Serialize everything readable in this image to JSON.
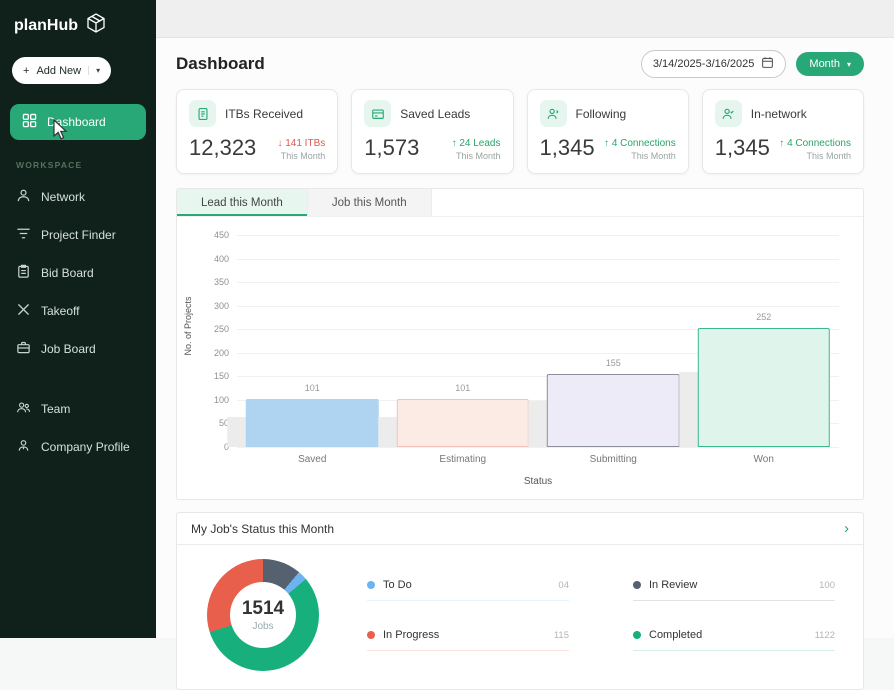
{
  "accent": "#28a877",
  "sidebar": {
    "logo": "planHub",
    "add_new": {
      "plus": "+",
      "label": "Add New",
      "caret": "▾"
    },
    "section_label": "WORKSPACE",
    "items": [
      {
        "label": "Dashboard",
        "icon": "dashboard-icon",
        "active": true
      },
      {
        "label": "Network",
        "icon": "person-icon"
      },
      {
        "label": "Project Finder",
        "icon": "filter-icon"
      },
      {
        "label": "Bid Board",
        "icon": "clipboard-icon"
      },
      {
        "label": "Takeoff",
        "icon": "takeoff-cross-icon"
      },
      {
        "label": "Job Board",
        "icon": "briefcase-icon"
      },
      {
        "label": "Team",
        "icon": "team-icon"
      },
      {
        "label": "Company Profile",
        "icon": "company-profile-icon"
      }
    ]
  },
  "header": {
    "title": "Dashboard",
    "date_range": "3/14/2025-3/16/2025",
    "period_button": {
      "label": "Month",
      "caret": "▾"
    }
  },
  "stats": [
    {
      "label": "ITBs Received",
      "value": "12,323",
      "arrow": "↓",
      "delta": "141 ITBs",
      "delta_color": "#e2574c",
      "sub": "This Month",
      "icon": "itb-document-icon"
    },
    {
      "label": "Saved Leads",
      "value": "1,573",
      "arrow": "↑",
      "delta": "24 Leads",
      "delta_color": "#27a567",
      "sub": "This Month",
      "icon": "saved-leads-card-icon"
    },
    {
      "label": "Following",
      "value": "1,345",
      "arrow": "↑",
      "delta": "4 Connections",
      "delta_color": "#27a567",
      "sub": "This Month",
      "icon": "following-person-icon"
    },
    {
      "label": "In-network",
      "value": "1,345",
      "arrow": "↑",
      "delta": "4 Connections",
      "delta_color": "#27a567",
      "sub": "This Month",
      "icon": "in-network-person-icon"
    }
  ],
  "tabs": [
    {
      "label": "Lead this Month",
      "active": true
    },
    {
      "label": "Job this Month",
      "active": false
    }
  ],
  "chart_data": [
    {
      "type": "bar",
      "categories": [
        "Saved",
        "Estimating",
        "Submitting",
        "Won"
      ],
      "values": [
        101,
        101,
        155,
        252
      ],
      "xlabel": "Status",
      "ylabel": "No. of Projects",
      "ylim": [
        0,
        450
      ],
      "yticks": [
        0,
        50,
        100,
        150,
        200,
        250,
        300,
        350,
        400,
        450
      ],
      "grid": true,
      "legend_position": "none",
      "bar_colors": [
        "#aed4f2",
        "#fcebe4",
        "#edebf7",
        "#dff4eb"
      ],
      "bar_borders": [
        "#aed4f2",
        "#f2c4b8",
        "#8a8f9b",
        "#3bb98e"
      ]
    },
    {
      "type": "pie",
      "title": "My Job's Status this Month",
      "center_value": "1514",
      "center_label": "Jobs",
      "segments": [
        {
          "label": "To Do",
          "value": "04",
          "color": "#6db3f2"
        },
        {
          "label": "In Review",
          "value": "100",
          "color": "#55616e"
        },
        {
          "label": "In Progress",
          "value": "115",
          "color": "#e8604c"
        },
        {
          "label": "Completed",
          "value": "1122",
          "color": "#17b07c"
        }
      ],
      "layout": {
        "start_deg": 0,
        "order": [
          "In Review",
          "To Do",
          "Completed",
          "In Progress"
        ],
        "sweep_deg": {
          "In Review": 40,
          "To Do": 10,
          "Completed": 202,
          "In Progress": 108
        }
      }
    }
  ],
  "jobs_card": {
    "title": "My Job's Status this Month",
    "chevron": "›"
  }
}
